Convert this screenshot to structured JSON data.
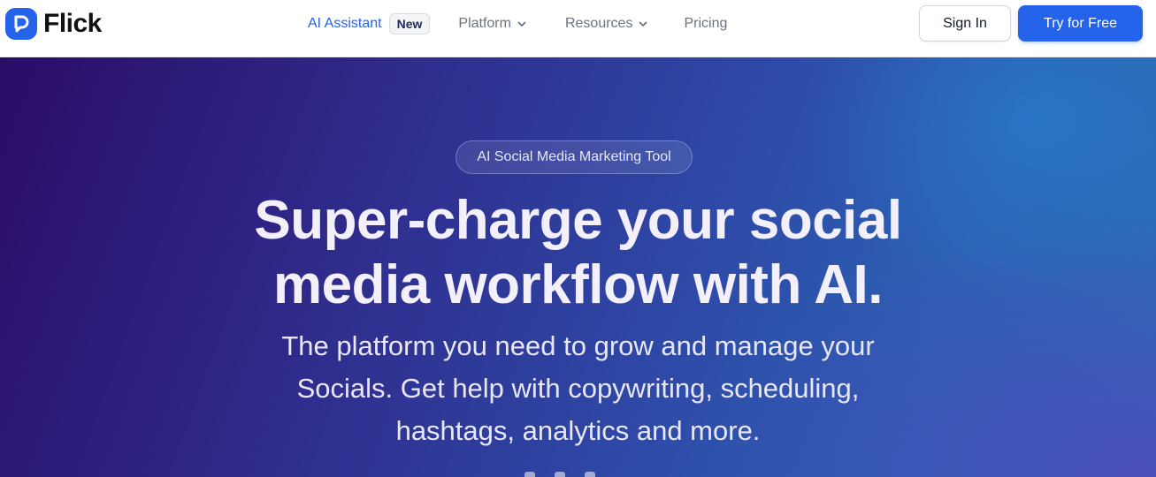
{
  "brand": {
    "name": "Flick",
    "logo_icon": "flick-logo-icon",
    "accent": "#2563eb"
  },
  "nav": {
    "ai_assistant": "AI Assistant",
    "ai_badge": "New",
    "platform": "Platform",
    "resources": "Resources",
    "pricing": "Pricing",
    "dropdown_icon": "chevron-down-icon"
  },
  "actions": {
    "sign_in": "Sign In",
    "try_free": "Try for Free"
  },
  "hero": {
    "pill": "AI Social Media Marketing Tool",
    "headline_line1": "Super-charge your social",
    "headline_line2": "media workflow with AI.",
    "sub_line1": "The platform you need to grow and manage your",
    "sub_line2": "Socials. Get help with copywriting, scheduling,",
    "sub_line3": "hashtags, analytics and more."
  }
}
